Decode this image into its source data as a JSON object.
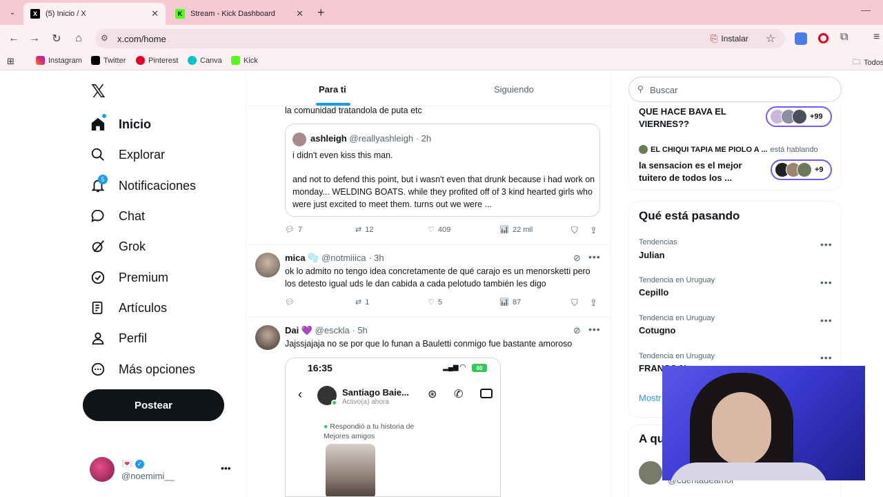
{
  "browser": {
    "tabs": [
      {
        "title": "(5) Inicio / X",
        "active": true
      },
      {
        "title": "Stream - Kick Dashboard",
        "active": false
      }
    ],
    "url": "x.com/home",
    "install_label": "Instalar",
    "bookmarks": [
      "Instagram",
      "Twitter",
      "Pinterest",
      "Canva",
      "Kick"
    ],
    "bookmarks_folder": "Todos"
  },
  "sidebar": {
    "items": [
      {
        "label": "Inicio",
        "icon": "home-icon"
      },
      {
        "label": "Explorar",
        "icon": "search-icon"
      },
      {
        "label": "Notificaciones",
        "icon": "bell-icon",
        "badge": "5"
      },
      {
        "label": "Chat",
        "icon": "chat-icon"
      },
      {
        "label": "Grok",
        "icon": "grok-icon"
      },
      {
        "label": "Premium",
        "icon": "premium-icon"
      },
      {
        "label": "Artículos",
        "icon": "articles-icon"
      },
      {
        "label": "Perfil",
        "icon": "person-icon"
      },
      {
        "label": "Más opciones",
        "icon": "more-icon"
      }
    ],
    "post_label": "Postear",
    "account": {
      "name": "💌",
      "handle": "@noemimi__"
    }
  },
  "feed": {
    "tabs": [
      "Para ti",
      "Siguiendo"
    ],
    "partial_text": "la comunidad tratandola de puta etc",
    "quote": {
      "name": "ashleigh",
      "handle": "@reallyashleigh",
      "time": "· 2h",
      "line1": "i didn't even kiss this man.",
      "line2": "and not to defend this point, but i wasn't even that drunk because i had work on monday... WELDING BOATS. while they profited off of 3 kind hearted girls who were just excited to meet them. turns out we were ..."
    },
    "stats1": {
      "replies": "7",
      "reposts": "12",
      "likes": "409",
      "views": "22 mil"
    },
    "post2": {
      "name": "mica",
      "emoji": "🫧",
      "handle": "@notmiiica",
      "time": "· 3h",
      "text": "ok lo admito no tengo idea concretamente de qué carajo es un menorsketti pero los detesto igual uds le dan cabida a cada pelotudo también les digo",
      "stats": {
        "replies": "",
        "reposts": "1",
        "likes": "5",
        "views": "87"
      }
    },
    "post3": {
      "name": "Dai",
      "emoji": "💜",
      "handle": "@esckla",
      "time": "· 5h",
      "text": "Jajssjajaja no se por que lo funan a Bauletti conmigo fue bastante amoroso",
      "screenshot": {
        "time": "16:35",
        "battery": "60",
        "contact": "Santiago Baie...",
        "status": "Activo(a) ahora",
        "reply_line1": "Respondió a tu historia de",
        "reply_line2": "Mejores amigos"
      }
    }
  },
  "right": {
    "search_placeholder": "Buscar",
    "spaces": [
      {
        "title": "QUE HACE BAVA EL VIERNES??",
        "count": "+99"
      },
      {
        "host": "EL CHIQUI TAPIA ME PIOLO A ...",
        "host_status": "está hablando",
        "title": "la sensacion es el mejor tuitero de todos los ...",
        "count": "+9"
      }
    ],
    "trending_title": "Qué está pasando",
    "trends": [
      {
        "label": "Tendencias",
        "name": "Julian"
      },
      {
        "label": "Tendencia en Uruguay",
        "name": "Cepillo"
      },
      {
        "label": "Tendencia en Uruguay",
        "name": "Cotugno"
      },
      {
        "label": "Tendencia en Uruguay",
        "name": "FRANCO N..."
      }
    ],
    "show_more": "Mostr",
    "who_to_follow": "A qu",
    "follow_handle": "@cuentadeamor"
  },
  "colors": {
    "accent": "#1d9bf0",
    "pill_border": "#7856ff",
    "tabbar": "#f6c9d4"
  }
}
